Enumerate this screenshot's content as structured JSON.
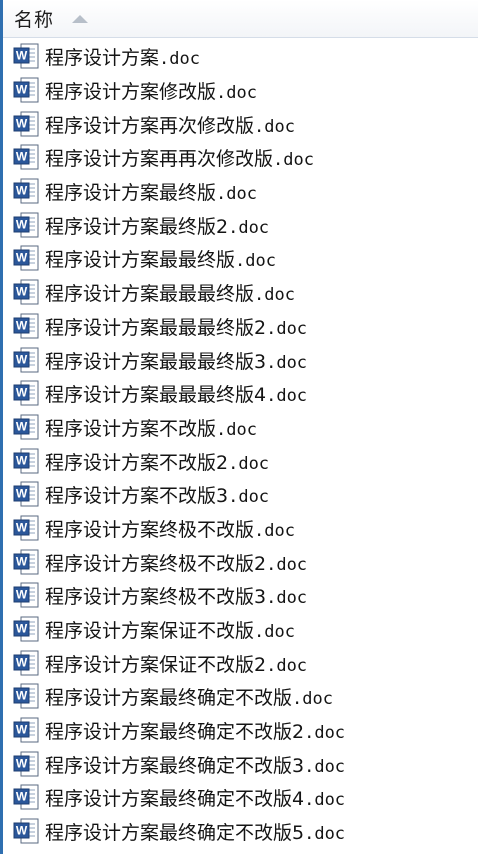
{
  "header": {
    "name_label": "名称",
    "sort_icon": "sort-ascending-icon"
  },
  "colors": {
    "selection_border": "#2f6fb0",
    "doc_icon_blue": "#2b579a",
    "sort_arrow": "#b7bfc9"
  },
  "files": [
    {
      "base": "程序设计方案",
      "ext": ".doc"
    },
    {
      "base": "程序设计方案修改版",
      "ext": ".doc"
    },
    {
      "base": "程序设计方案再次修改版",
      "ext": ".doc"
    },
    {
      "base": "程序设计方案再再次修改版",
      "ext": ".doc"
    },
    {
      "base": "程序设计方案最终版",
      "ext": ".doc"
    },
    {
      "base": "程序设计方案最终版2",
      "ext": ".doc"
    },
    {
      "base": "程序设计方案最最终版",
      "ext": ".doc"
    },
    {
      "base": "程序设计方案最最最终版",
      "ext": ".doc"
    },
    {
      "base": "程序设计方案最最最终版2",
      "ext": ".doc"
    },
    {
      "base": "程序设计方案最最最终版3",
      "ext": ".doc"
    },
    {
      "base": "程序设计方案最最最终版4",
      "ext": ".doc"
    },
    {
      "base": "程序设计方案不改版",
      "ext": ".doc"
    },
    {
      "base": "程序设计方案不改版2",
      "ext": ".doc"
    },
    {
      "base": "程序设计方案不改版3",
      "ext": ".doc"
    },
    {
      "base": "程序设计方案终极不改版",
      "ext": ".doc"
    },
    {
      "base": "程序设计方案终极不改版2",
      "ext": ".doc"
    },
    {
      "base": "程序设计方案终极不改版3",
      "ext": ".doc"
    },
    {
      "base": "程序设计方案保证不改版",
      "ext": ".doc"
    },
    {
      "base": "程序设计方案保证不改版2",
      "ext": ".doc"
    },
    {
      "base": "程序设计方案最终确定不改版",
      "ext": ".doc"
    },
    {
      "base": "程序设计方案最终确定不改版2",
      "ext": ".doc"
    },
    {
      "base": "程序设计方案最终确定不改版3",
      "ext": ".doc"
    },
    {
      "base": "程序设计方案最终确定不改版4",
      "ext": ".doc"
    },
    {
      "base": "程序设计方案最终确定不改版5",
      "ext": ".doc"
    }
  ]
}
